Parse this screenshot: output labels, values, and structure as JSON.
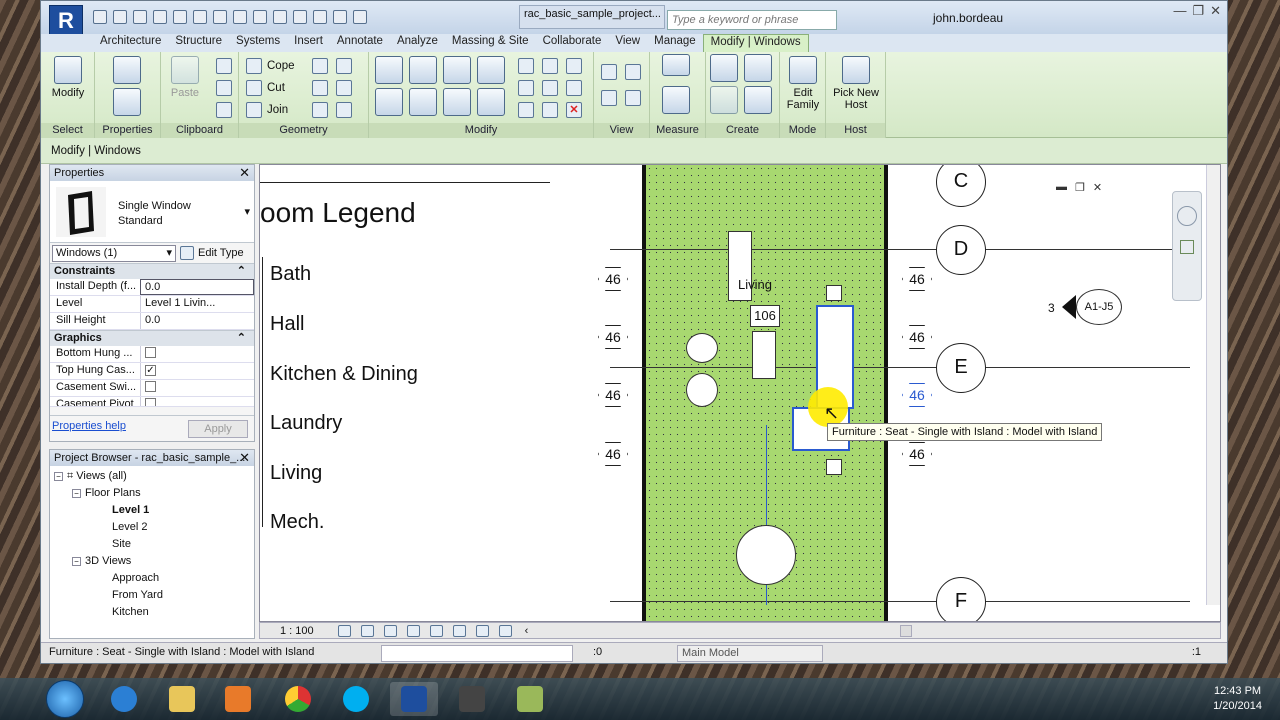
{
  "window": {
    "doc_title": "rac_basic_sample_project...",
    "search_placeholder": "Type a keyword or phrase",
    "user": "john.bordeau"
  },
  "tabs": [
    "Architecture",
    "Structure",
    "Systems",
    "Insert",
    "Annotate",
    "Analyze",
    "Massing & Site",
    "Collaborate",
    "View",
    "Manage",
    "Modify | Windows"
  ],
  "ribbon": {
    "modify": "Modify",
    "paste": "Paste",
    "cope": "Cope",
    "cut": "Cut",
    "join": "Join",
    "edit_family": "Edit Family",
    "pick_new_host": "Pick New Host",
    "panels": {
      "select": "Select",
      "properties": "Properties",
      "clipboard": "Clipboard",
      "geometry": "Geometry",
      "modify": "Modify",
      "view": "View",
      "measure": "Measure",
      "create": "Create",
      "mode": "Mode",
      "host": "Host"
    }
  },
  "options_bar": "Modify | Windows",
  "properties": {
    "title": "Properties",
    "type_name_1": "Single Window",
    "type_name_2": "Standard",
    "instance": "Windows (1)",
    "edit_type": "Edit Type",
    "groups": {
      "constraints": "Constraints",
      "graphics": "Graphics"
    },
    "rows": {
      "install_depth": {
        "k": "Install Depth (f...",
        "v": "0.0"
      },
      "level": {
        "k": "Level",
        "v": "Level 1 Livin..."
      },
      "sill_height": {
        "k": "Sill Height",
        "v": "0.0"
      },
      "bottom_hung": {
        "k": "Bottom Hung ..."
      },
      "top_hung": {
        "k": "Top Hung Cas..."
      },
      "casement_swi": {
        "k": "Casement Swi..."
      },
      "casement_piv": {
        "k": "Casement Pivot"
      }
    },
    "help": "Properties help",
    "apply": "Apply"
  },
  "browser": {
    "title": "Project Browser - rac_basic_sample_...",
    "nodes": [
      "Views (all)",
      "Floor Plans",
      "Level 1",
      "Level 2",
      "Site",
      "3D Views",
      "Approach",
      "From Yard",
      "Kitchen"
    ]
  },
  "legend": {
    "title": "oom Legend",
    "items": [
      "Bath",
      "Hall",
      "Kitchen & Dining",
      "Laundry",
      "Living",
      "Mech."
    ]
  },
  "plan": {
    "grids": [
      "C",
      "D",
      "E",
      "F"
    ],
    "tags": [
      "46",
      "46",
      "46",
      "46",
      "46",
      "46",
      "46",
      "46"
    ],
    "room_label": "Living",
    "room_number": "106",
    "section_number": "3",
    "section_ref": "A1-J5"
  },
  "tooltip": "Furniture : Seat - Single with Island : Model with Island",
  "viewbar": {
    "scale": "1 : 100"
  },
  "status": {
    "text": "Furniture : Seat - Single with Island : Model with Island",
    "count": ":0",
    "model": "Main Model",
    "filter": ":1"
  },
  "clock": {
    "time": "12:43 PM",
    "date": "1/20/2014"
  }
}
